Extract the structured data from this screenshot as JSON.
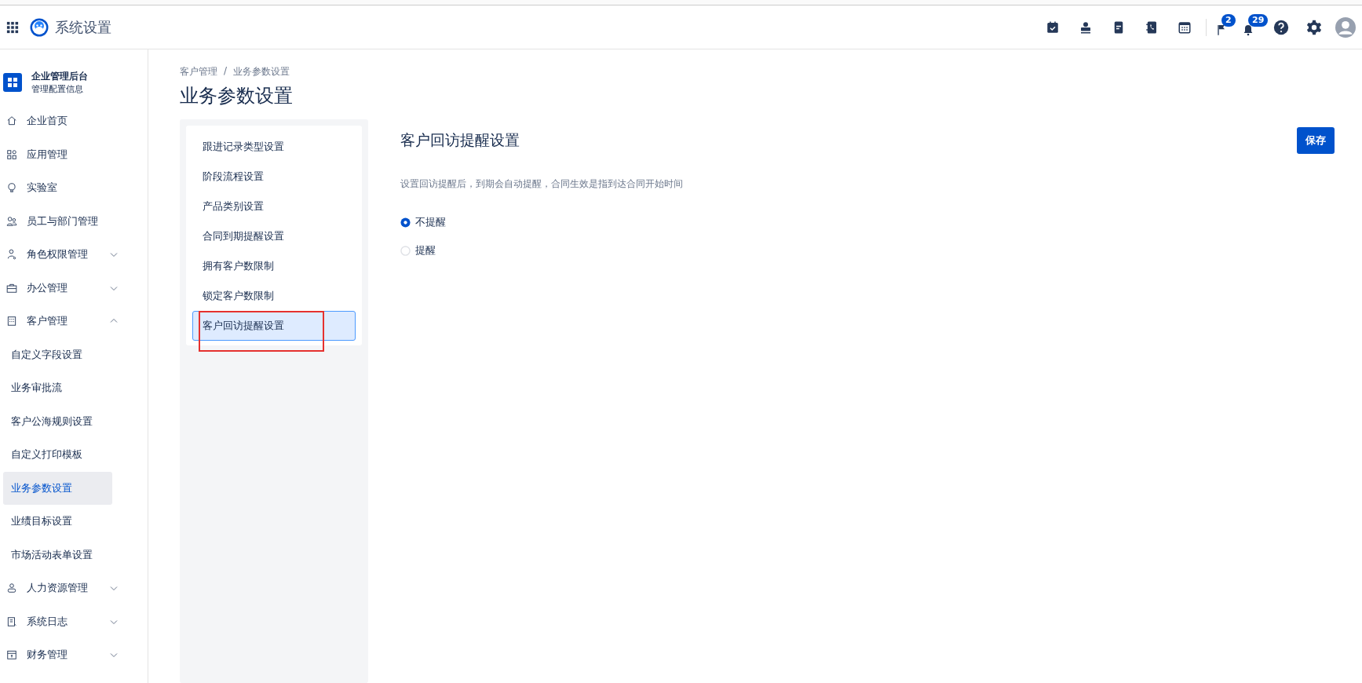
{
  "header": {
    "title": "系统设置",
    "badges": [
      {
        "count": "2"
      },
      {
        "count": "29"
      }
    ]
  },
  "sidebar": {
    "title": "企业管理后台",
    "subtitle": "管理配置信息",
    "items": [
      {
        "label": "企业首页"
      },
      {
        "label": "应用管理"
      },
      {
        "label": "实验室"
      },
      {
        "label": "员工与部门管理"
      },
      {
        "label": "角色权限管理",
        "expanded": false
      },
      {
        "label": "办公管理",
        "expanded": false
      },
      {
        "label": "客户管理",
        "expanded": true,
        "children": [
          {
            "label": "自定义字段设置",
            "selected": false
          },
          {
            "label": "业务审批流",
            "selected": false
          },
          {
            "label": "客户公海规则设置",
            "selected": false
          },
          {
            "label": "自定义打印模板",
            "selected": false
          },
          {
            "label": "业务参数设置",
            "selected": true
          },
          {
            "label": "业绩目标设置",
            "selected": false
          },
          {
            "label": "市场活动表单设置",
            "selected": false
          }
        ]
      },
      {
        "label": "人力资源管理",
        "expanded": false
      },
      {
        "label": "系统日志",
        "expanded": false
      },
      {
        "label": "财务管理",
        "expanded": false
      }
    ]
  },
  "breadcrumb": [
    "客户管理",
    "/",
    "业务参数设置"
  ],
  "page_title": "业务参数设置",
  "settings_menu": [
    {
      "label": "跟进记录类型设置",
      "selected": false
    },
    {
      "label": "阶段流程设置",
      "selected": false
    },
    {
      "label": "产品类别设置",
      "selected": false
    },
    {
      "label": "合同到期提醒设置",
      "selected": false
    },
    {
      "label": "拥有客户数限制",
      "selected": false
    },
    {
      "label": "锁定客户数限制",
      "selected": false
    },
    {
      "label": "客户回访提醒设置",
      "selected": true,
      "annotated": true
    }
  ],
  "panel": {
    "title": "客户回访提醒设置",
    "save_button": "保存",
    "description": "设置回访提醒后，到期会自动提醒，合同生效是指到达合同开始时间",
    "options": [
      {
        "label": "不提醒",
        "selected": true
      },
      {
        "label": "提醒",
        "selected": false
      }
    ]
  }
}
